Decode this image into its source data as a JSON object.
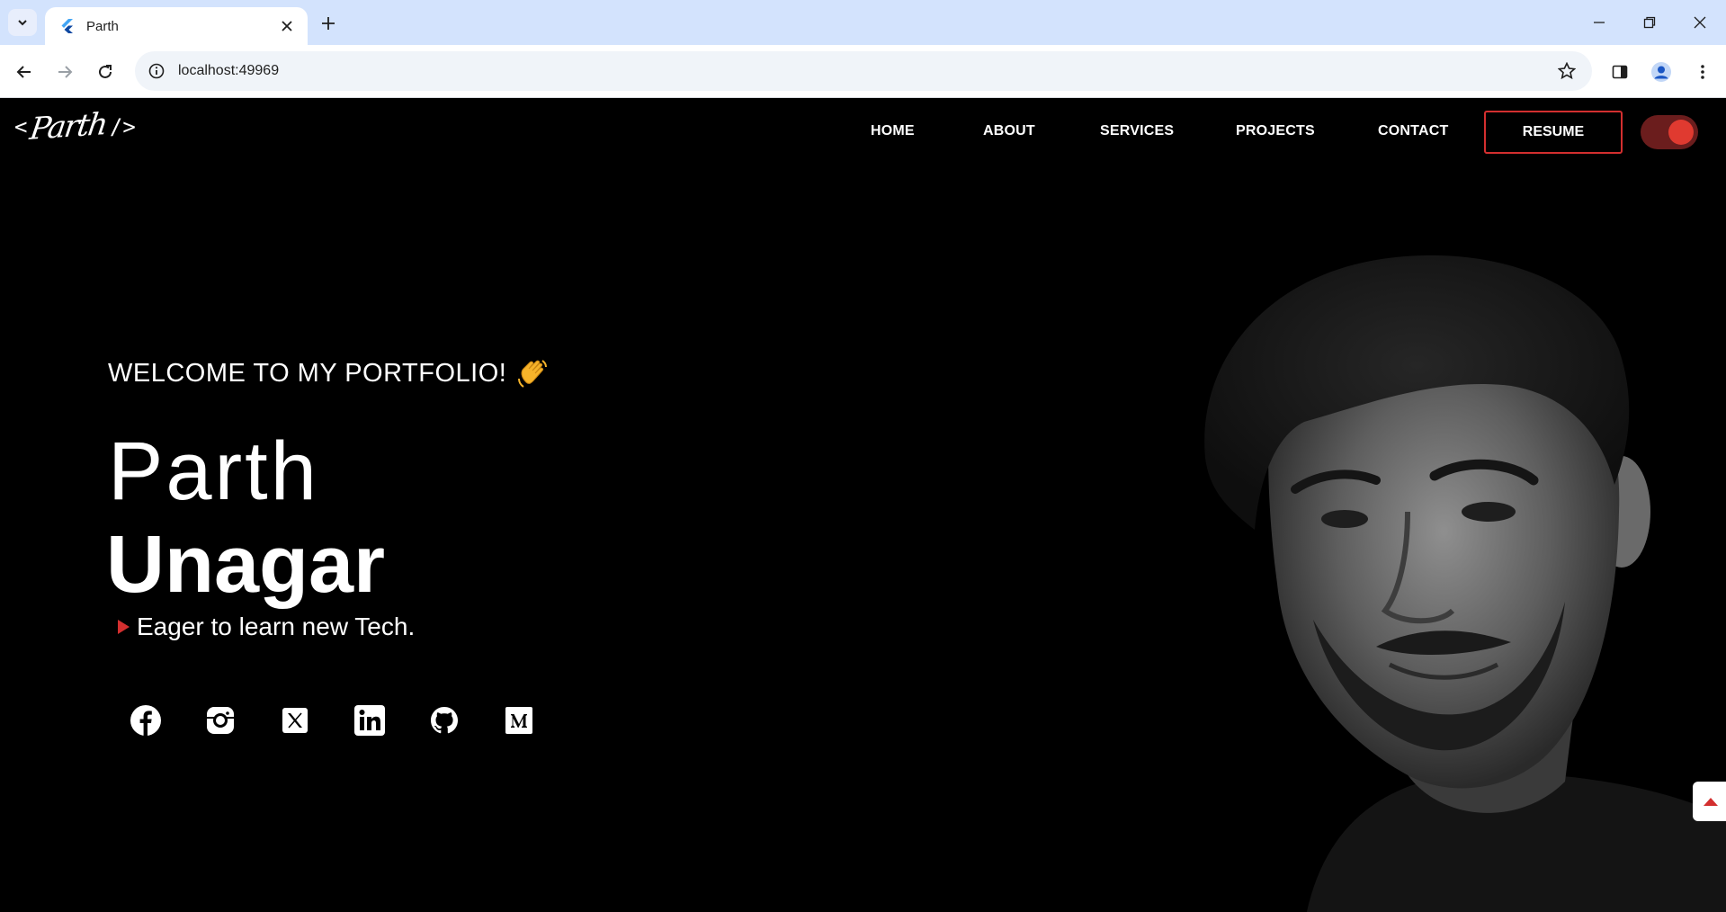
{
  "browser": {
    "tab_title": "Parth",
    "url": "localhost:49969"
  },
  "site": {
    "logo_left": "<",
    "logo_name": "Parth",
    "logo_right": "/>",
    "nav": [
      {
        "label": "HOME"
      },
      {
        "label": "ABOUT"
      },
      {
        "label": "SERVICES"
      },
      {
        "label": "PROJECTS"
      },
      {
        "label": "CONTACT"
      }
    ],
    "resume_label": "RESUME",
    "theme_toggle_on": true
  },
  "hero": {
    "welcome": "WELCOME TO MY PORTFOLIO!",
    "first_name": "Parth",
    "last_name": "Unagar",
    "tagline": "Eager to learn new Tech.",
    "socials": [
      {
        "icon": "facebook-icon"
      },
      {
        "icon": "instagram-icon"
      },
      {
        "icon": "x-twitter-icon"
      },
      {
        "icon": "linkedin-icon"
      },
      {
        "icon": "github-icon"
      },
      {
        "icon": "medium-icon"
      }
    ]
  },
  "colors": {
    "accent": "#d32f2f",
    "background": "#000000",
    "tab_strip": "#d3e3fd"
  }
}
